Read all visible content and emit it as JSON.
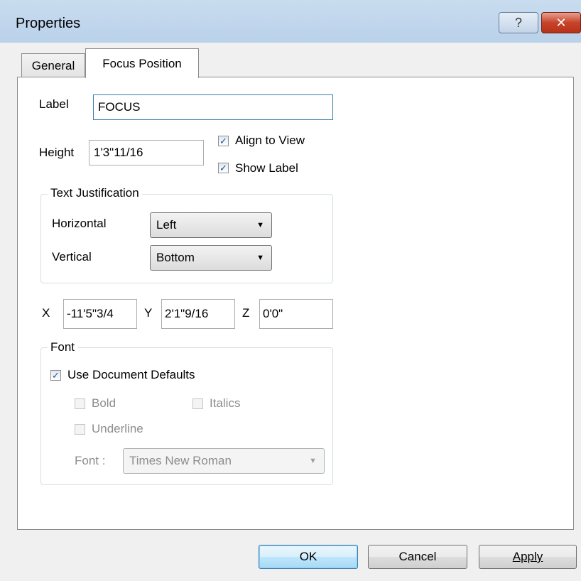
{
  "window": {
    "title": "Properties",
    "help_glyph": "?",
    "close_glyph": "✕"
  },
  "tabs": [
    {
      "label": "General",
      "active": false
    },
    {
      "label": "Focus Position",
      "active": true
    }
  ],
  "form": {
    "label_caption": "Label",
    "label_value": "FOCUS",
    "height_caption": "Height",
    "height_value": "1'3\"11/16",
    "align_to_view": {
      "label": "Align to View",
      "checked": true
    },
    "show_label": {
      "label": "Show Label",
      "checked": true
    }
  },
  "text_justification": {
    "title": "Text Justification",
    "horizontal_caption": "Horizontal",
    "horizontal_value": "Left",
    "vertical_caption": "Vertical",
    "vertical_value": "Bottom"
  },
  "coords": {
    "x_caption": "X",
    "x_value": "-11'5\"3/4",
    "y_caption": "Y",
    "y_value": "2'1\"9/16",
    "z_caption": "Z",
    "z_value": "0'0\""
  },
  "font": {
    "title": "Font",
    "use_defaults": {
      "label": "Use Document Defaults",
      "checked": true
    },
    "bold": {
      "label": "Bold",
      "checked": false
    },
    "italics": {
      "label": "Italics",
      "checked": false
    },
    "underline": {
      "label": "Underline",
      "checked": false
    },
    "font_caption": "Font :",
    "font_value": "Times New Roman"
  },
  "buttons": {
    "ok": "OK",
    "cancel": "Cancel",
    "apply": "Apply"
  },
  "colors": {
    "titlebar": "#b9d1ea",
    "panel": "#ffffff",
    "check": "#21538a",
    "close": "#c7432a"
  }
}
